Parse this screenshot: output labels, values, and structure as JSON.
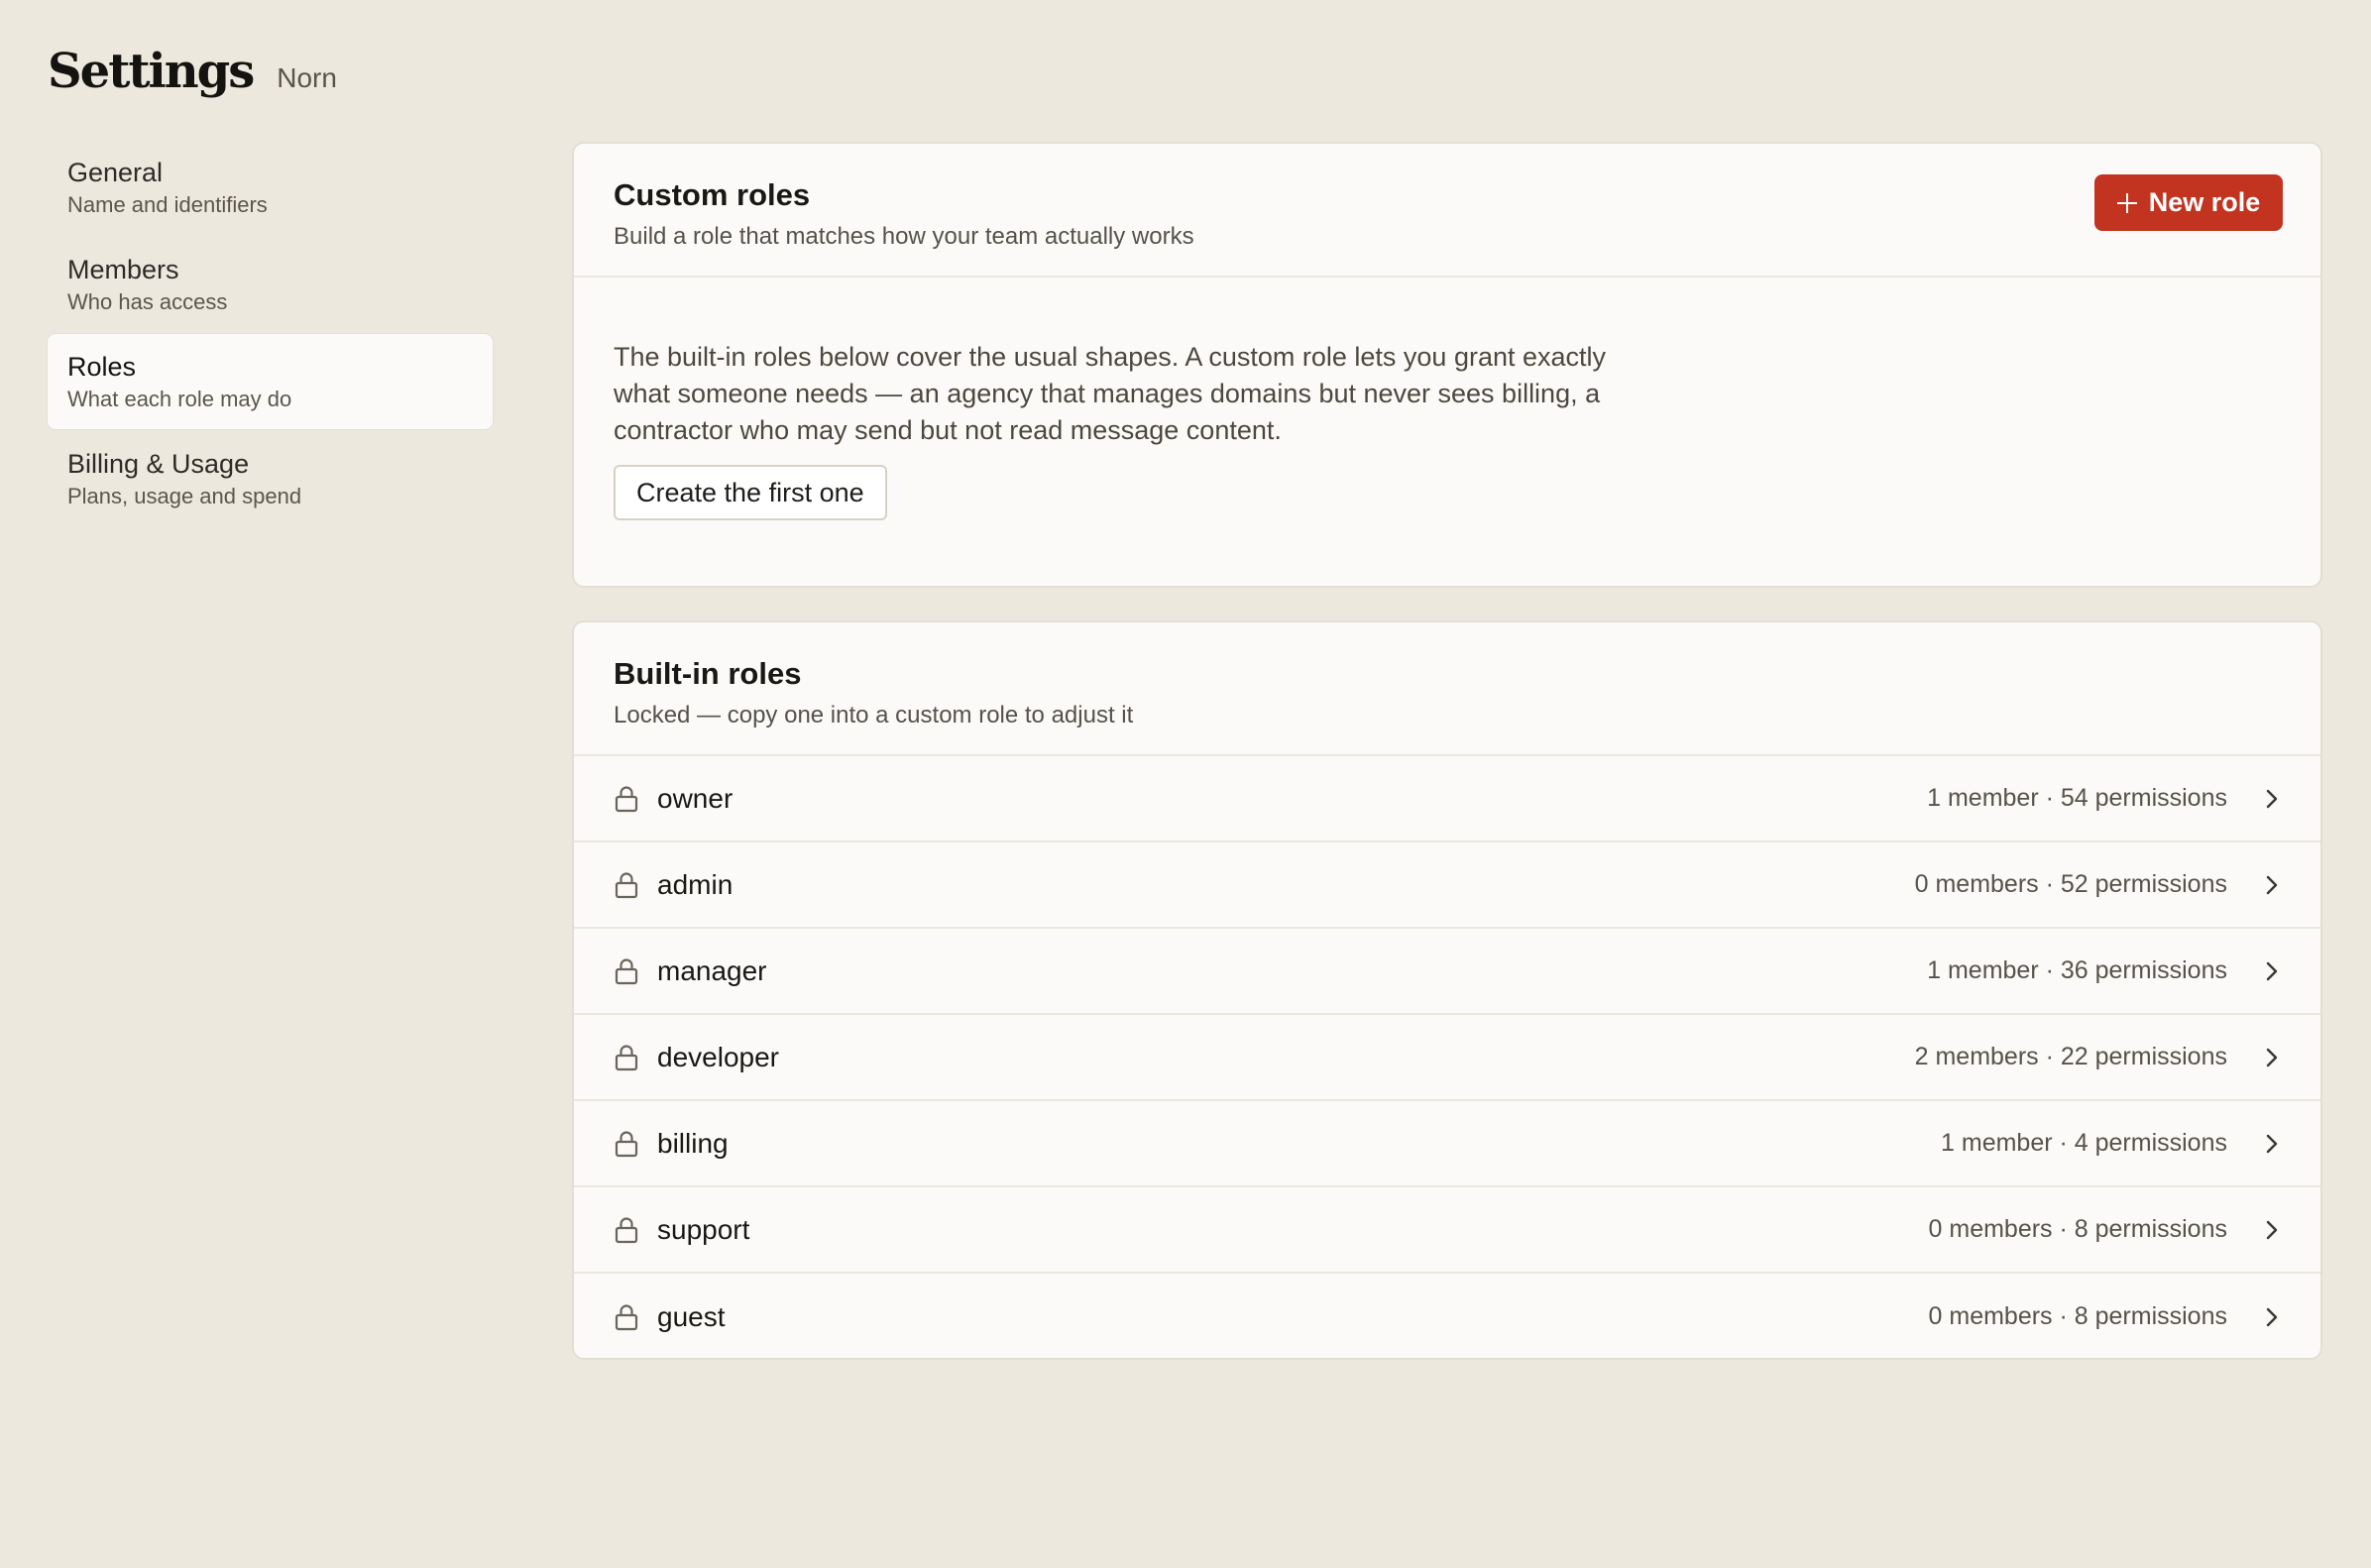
{
  "header": {
    "title": "Settings",
    "workspace": "Norn"
  },
  "sidebar": {
    "items": [
      {
        "label": "General",
        "desc": "Name and identifiers"
      },
      {
        "label": "Members",
        "desc": "Who has access"
      },
      {
        "label": "Roles",
        "desc": "What each role may do",
        "active": true
      },
      {
        "label": "Billing & Usage",
        "desc": "Plans, usage and spend"
      }
    ]
  },
  "custom_roles": {
    "title": "Custom roles",
    "subtitle": "Build a role that matches how your team actually works",
    "new_role_label": "New role",
    "empty_text": "The built-in roles below cover the usual shapes. A custom role lets you grant exactly what someone needs — an agency that manages domains but never sees billing, a contractor who may send but not read message content.",
    "create_first_label": "Create the first one"
  },
  "builtin_roles": {
    "title": "Built-in roles",
    "subtitle": "Locked — copy one into a custom role to adjust it",
    "roles": [
      {
        "name": "owner",
        "meta": "1 member · 54 permissions"
      },
      {
        "name": "admin",
        "meta": "0 members · 52 permissions"
      },
      {
        "name": "manager",
        "meta": "1 member · 36 permissions"
      },
      {
        "name": "developer",
        "meta": "2 members · 22 permissions"
      },
      {
        "name": "billing",
        "meta": "1 member · 4 permissions"
      },
      {
        "name": "support",
        "meta": "0 members · 8 permissions"
      },
      {
        "name": "guest",
        "meta": "0 members · 8 permissions"
      }
    ]
  },
  "colors": {
    "background": "#ece8de",
    "card": "#fbfaf8",
    "accent": "#c2341f"
  },
  "icons": [
    "plus-icon",
    "lock-icon",
    "chevron-right-icon"
  ]
}
